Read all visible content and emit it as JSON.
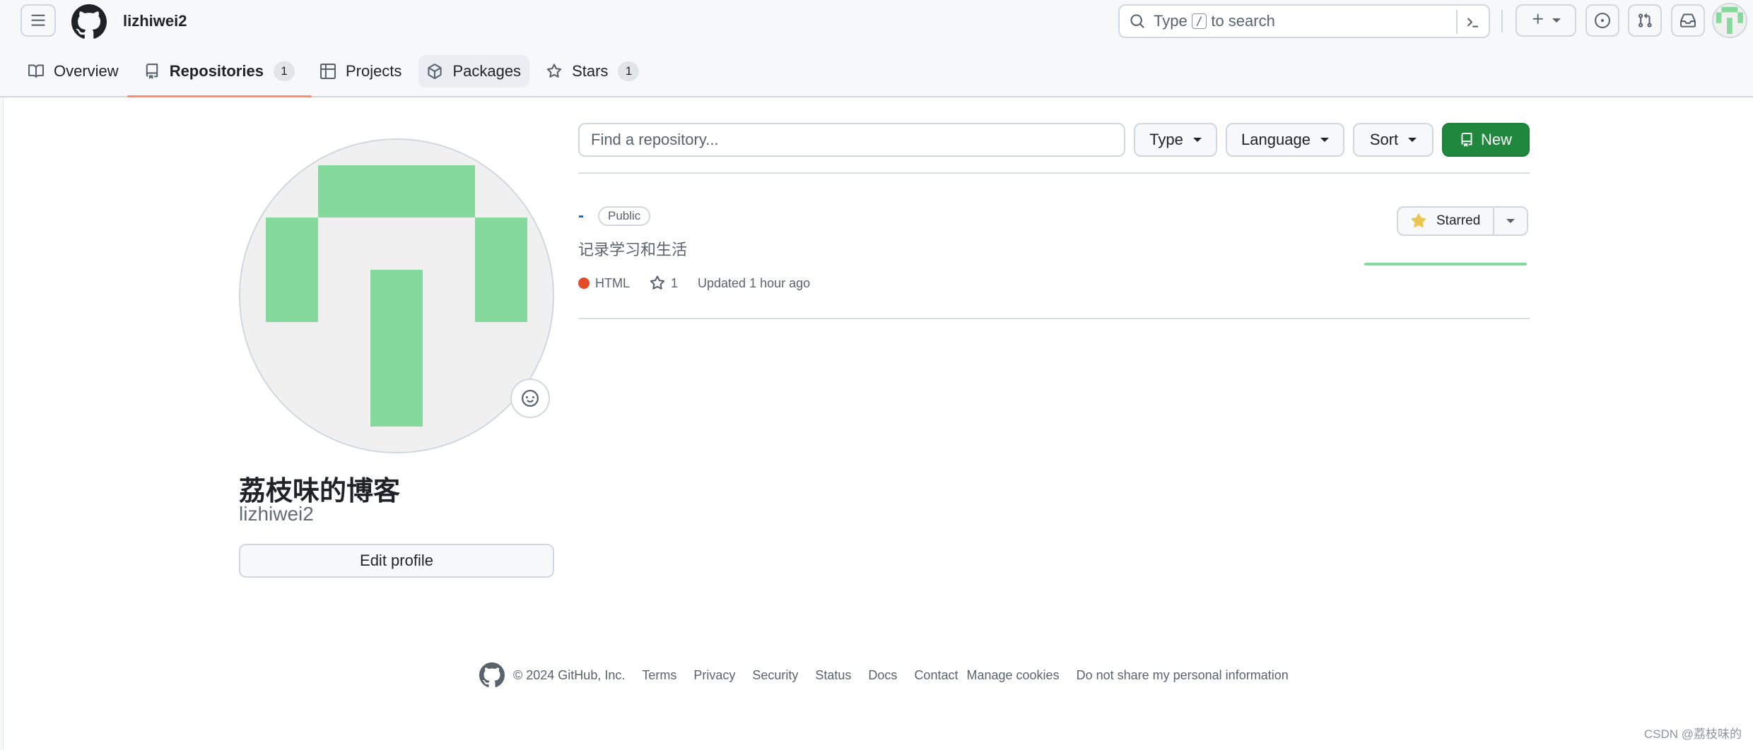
{
  "header": {
    "username": "lizhiwei2",
    "search_prefix": "Type",
    "search_key": "/",
    "search_suffix": "to search",
    "icons": {
      "menu": "hamburger-icon",
      "logo": "github-mark-icon",
      "search": "search-icon",
      "command": "terminal-icon",
      "plus": "plus-icon",
      "issues": "issue-opened-icon",
      "pulls": "git-pull-request-icon",
      "inbox": "inbox-icon"
    }
  },
  "tabs": [
    {
      "label": "Overview",
      "icon": "book-icon"
    },
    {
      "label": "Repositories",
      "icon": "repo-icon",
      "count": "1",
      "active": true
    },
    {
      "label": "Projects",
      "icon": "table-icon"
    },
    {
      "label": "Packages",
      "icon": "package-icon"
    },
    {
      "label": "Stars",
      "icon": "star-icon",
      "count": "1"
    }
  ],
  "profile": {
    "display_name": "荔枝味的博客",
    "login": "lizhiwei2",
    "edit_label": "Edit profile",
    "avatar_colors": {
      "background": "#f0f0f0",
      "blocks": "#85d99d"
    }
  },
  "filters": {
    "search_placeholder": "Find a repository...",
    "type_label": "Type",
    "language_label": "Language",
    "sort_label": "Sort",
    "new_label": "New"
  },
  "repos": [
    {
      "name": "-",
      "visibility": "Public",
      "description": "记录学习和生活",
      "language": "HTML",
      "language_color": "#e34c26",
      "stars": "1",
      "updated": "Updated 1 hour ago",
      "star_button": "Starred"
    }
  ],
  "footer": {
    "copyright": "© 2024 GitHub, Inc.",
    "links": [
      "Terms",
      "Privacy",
      "Security",
      "Status",
      "Docs",
      "Contact",
      "Manage cookies",
      "Do not share my personal information"
    ]
  },
  "watermark": "CSDN @荔枝味的",
  "colors": {
    "accent_green": "#1f883d",
    "tab_underline": "#fd8c73",
    "link_blue": "#0969da",
    "star_yellow": "#eac54f"
  }
}
